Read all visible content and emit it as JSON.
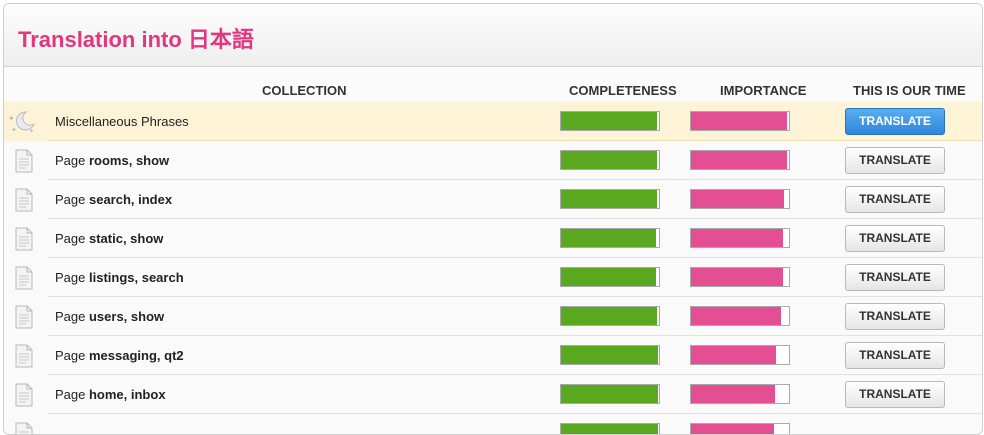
{
  "page": {
    "title": "Translation into 日本語"
  },
  "columns": {
    "collection": "COLLECTION",
    "completeness": "COMPLETENESS",
    "importance": "IMPORTANCE",
    "action": "THIS IS OUR TIME"
  },
  "rows": [
    {
      "prefix": "",
      "name": "Miscellaneous Phrases",
      "completeness": 0.98,
      "importance": 0.98,
      "button": "TRANSLATE",
      "icon": "moon-stars-icon",
      "primary": true
    },
    {
      "prefix": "Page ",
      "name": "rooms, show",
      "completeness": 0.98,
      "importance": 0.98,
      "button": "TRANSLATE",
      "icon": "document-icon",
      "primary": false
    },
    {
      "prefix": "Page ",
      "name": "search, index",
      "completeness": 0.98,
      "importance": 0.95,
      "button": "TRANSLATE",
      "icon": "document-icon",
      "primary": false
    },
    {
      "prefix": "Page ",
      "name": "static, show",
      "completeness": 0.97,
      "importance": 0.94,
      "button": "TRANSLATE",
      "icon": "document-icon",
      "primary": false
    },
    {
      "prefix": "Page ",
      "name": "listings, search",
      "completeness": 0.97,
      "importance": 0.94,
      "button": "TRANSLATE",
      "icon": "document-icon",
      "primary": false
    },
    {
      "prefix": "Page ",
      "name": "users, show",
      "completeness": 0.98,
      "importance": 0.92,
      "button": "TRANSLATE",
      "icon": "document-icon",
      "primary": false
    },
    {
      "prefix": "Page ",
      "name": "messaging, qt2",
      "completeness": 0.99,
      "importance": 0.87,
      "button": "TRANSLATE",
      "icon": "document-icon",
      "primary": false
    },
    {
      "prefix": "Page ",
      "name": "home, inbox",
      "completeness": 0.99,
      "importance": 0.86,
      "button": "TRANSLATE",
      "icon": "document-icon",
      "primary": false
    },
    {
      "prefix": "",
      "name": "",
      "completeness": 0.99,
      "importance": 0.85,
      "button": "",
      "icon": "document-icon",
      "primary": false
    }
  ],
  "colors": {
    "title": "#e2367f",
    "completeness": "#59a81f",
    "importance": "#e44e93",
    "primary_button": "#3b95e3"
  }
}
